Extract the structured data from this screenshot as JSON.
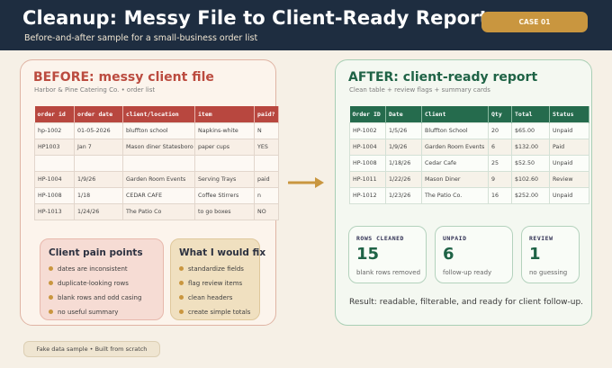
{
  "header": {
    "title": "Cleanup: Messy File to Client-Ready Report",
    "subtitle": "Before-and-after sample for a small-business order list",
    "case_badge": "CASE 01"
  },
  "before": {
    "title": "BEFORE: messy client file",
    "subtitle": "Harbor & Pine Catering Co. • order list",
    "columns": [
      "order id",
      "order date",
      "client/location",
      "item",
      "paid?"
    ],
    "rows": [
      [
        " hp-1002",
        "01-05-2026",
        "bluffton school",
        "Napkins-white",
        "N"
      ],
      [
        "HP1003",
        "Jan 7",
        "Mason diner Statesboro",
        "paper cups",
        "YES"
      ],
      [
        "",
        "",
        "",
        "",
        ""
      ],
      [
        "HP-1004",
        "1/9/26",
        "Garden Room Events",
        "Serving Trays",
        "paid"
      ],
      [
        "HP-1008",
        "1/18",
        "CEDAR CAFE",
        "Coffee Stirrers",
        "n"
      ],
      [
        "HP-1013",
        "1/24/26",
        "The Patio Co",
        "to go boxes",
        "NO"
      ]
    ]
  },
  "pain_points": {
    "title": "Client pain points",
    "items": [
      "dates are inconsistent",
      "duplicate-looking rows",
      "blank rows and odd casing",
      "no useful summary"
    ]
  },
  "fixes": {
    "title": "What I would fix",
    "items": [
      "standardize fields",
      "flag review items",
      "clean headers",
      "create simple totals"
    ]
  },
  "after": {
    "title": "AFTER: client-ready report",
    "subtitle": "Clean table + review flags + summary cards",
    "columns": [
      "Order ID",
      "Date",
      "Client",
      "Qty",
      "Total",
      "Status"
    ],
    "rows": [
      [
        "HP-1002",
        "1/5/26",
        "Bluffton School",
        "20",
        "$65.00",
        "Unpaid"
      ],
      [
        "HP-1004",
        "1/9/26",
        "Garden Room Events",
        "6",
        "$132.00",
        "Paid"
      ],
      [
        "HP-1008",
        "1/18/26",
        "Cedar Cafe",
        "25",
        "$52.50",
        "Unpaid"
      ],
      [
        "HP-1011",
        "1/22/26",
        "Mason Diner",
        "9",
        "$102.60",
        "Review"
      ],
      [
        "HP-1012",
        "1/23/26",
        "The Patio Co.",
        "16",
        "$252.00",
        "Unpaid"
      ]
    ]
  },
  "stats": [
    {
      "label": "ROWS CLEANED",
      "value": "15",
      "caption": "blank rows removed"
    },
    {
      "label": "UNPAID",
      "value": "6",
      "caption": "follow-up ready"
    },
    {
      "label": "REVIEW",
      "value": "1",
      "caption": "no guessing"
    }
  ],
  "result_text": "Result: readable, filterable, and ready for client follow-up.",
  "footer": "Fake data sample • Built from scratch",
  "icons": {
    "arrow": "right-arrow-icon"
  },
  "colors": {
    "header_bg": "#1e2d40",
    "badge": "#c9963f",
    "before_accent": "#b8473f",
    "after_accent": "#256b4d",
    "bullet": "#c9963f"
  }
}
